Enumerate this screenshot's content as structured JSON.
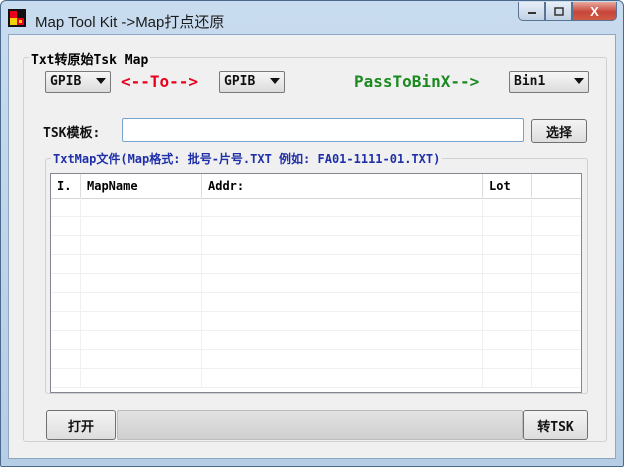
{
  "window": {
    "title": "Map Tool Kit ->Map打点还原",
    "close_glyph": "X"
  },
  "group_main": {
    "legend": "Txt转原始Tsk Map"
  },
  "combos": {
    "source_format": "GPIB",
    "target_format": "GPIB",
    "bin": "Bin1"
  },
  "labels": {
    "to_arrow": "<--To-->",
    "pass_to_bin": "PassToBinX-->",
    "tsk_template": "TSK模板:"
  },
  "tsk_input": {
    "value": ""
  },
  "buttons": {
    "select": "选择",
    "open": "打开",
    "convert": "转TSK"
  },
  "group_txtmap": {
    "legend": "TxtMap文件(Map格式: 批号-片号.TXT 例如: FA01-1111-01.TXT)"
  },
  "table": {
    "columns": [
      "I.",
      "MapName",
      "Addr:",
      "Lot",
      ""
    ],
    "rows": []
  },
  "progress": {
    "fraction": 0
  },
  "colors": {
    "to_arrow": "#e8001c",
    "pass_to_bin": "#1a8a20",
    "legend_blue": "#1f2fa8"
  }
}
